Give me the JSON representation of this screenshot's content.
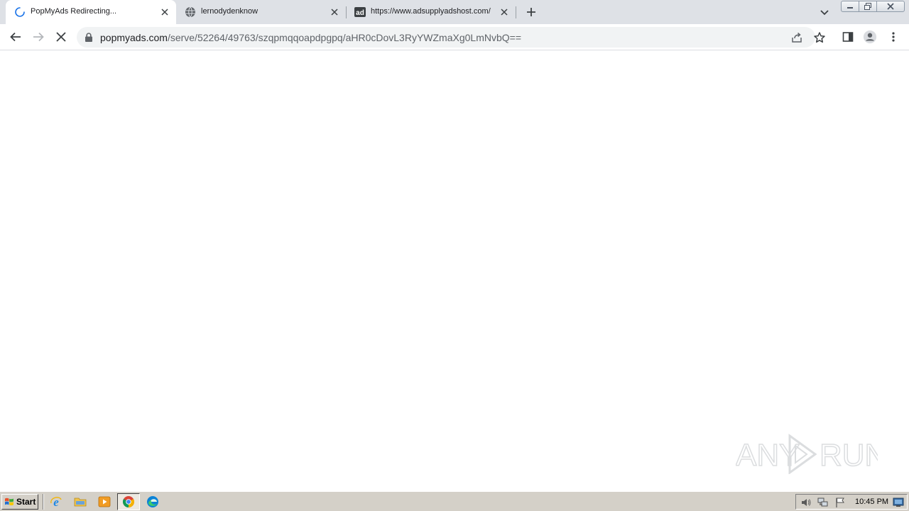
{
  "browser": {
    "tabs": [
      {
        "title": "PopMyAds Redirecting...",
        "favicon": "loading-spinner-icon",
        "active": true
      },
      {
        "title": "lernodydenknow",
        "favicon": "globe-icon",
        "active": false
      },
      {
        "title": "https://www.adsupplyadshost.com/",
        "favicon": "ad-icon",
        "active": false
      }
    ],
    "address": {
      "host": "popmyads.com",
      "path": "/serve/52264/49763/szqpmqqoapdpgpq/aHR0cDovL3RyYWZmaXg0LmNvbQ=="
    },
    "colors": {
      "tabstrip": "#dee1e6",
      "omnibox": "#f1f3f4",
      "accent": "#1a73e8"
    }
  },
  "watermark": {
    "text": "ANY RUN"
  },
  "taskbar": {
    "start_label": "Start",
    "quick_launch": [
      "internet-explorer-icon",
      "folder-icon",
      "media-player-icon",
      "chrome-icon",
      "edge-icon"
    ],
    "clock": "10:45 PM",
    "tray_icons": [
      "volume-icon",
      "network-icon",
      "flag-icon",
      "monitor-icon"
    ]
  }
}
